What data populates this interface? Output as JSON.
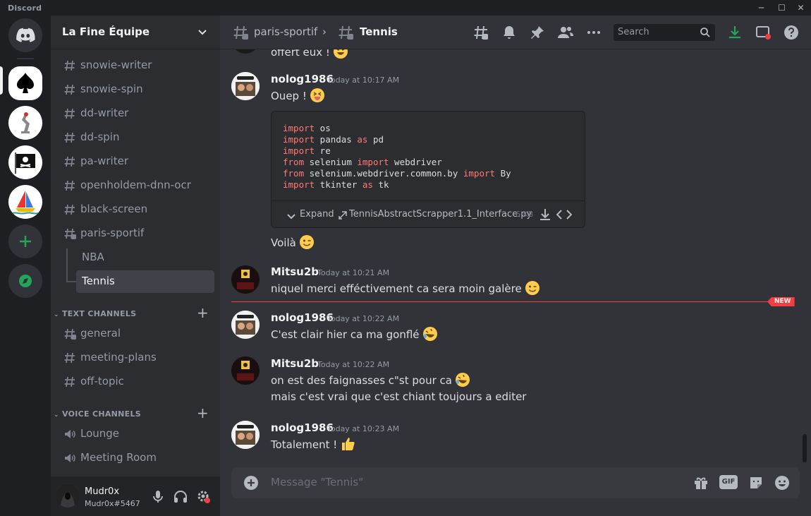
{
  "app": {
    "title": "Discord"
  },
  "window_controls": {
    "minimize": "─",
    "maximize": "☐",
    "close": "✕"
  },
  "server": {
    "name": "La Fine Équipe"
  },
  "channels": {
    "top": [
      "snowie-writer",
      "snowie-spin",
      "dd-writer",
      "dd-spin",
      "pa-writer",
      "openholdem-dnn-ocr",
      "black-screen",
      "paris-sportif"
    ],
    "threads": [
      "NBA",
      "Tennis"
    ],
    "text_category": "TEXT CHANNELS",
    "text": [
      "general",
      "meeting-plans",
      "off-topic"
    ],
    "voice_category": "VOICE CHANNELS",
    "voice": [
      "Lounge",
      "Meeting Room"
    ]
  },
  "user": {
    "name": "Mudr0x",
    "tag": "Mudr0x#5467"
  },
  "header": {
    "parent": "paris-sportif",
    "separator": "›",
    "thread": "Tennis",
    "search_placeholder": "Search"
  },
  "messages": {
    "partial_text": "offert eux !",
    "m1": {
      "author": "nolog1986",
      "time": "Today at 10:17 AM",
      "text": "Ouep !",
      "after_text": "Voilà"
    },
    "code": {
      "lines": [
        [
          [
            "kw",
            "import"
          ],
          [
            "t",
            " os"
          ]
        ],
        [
          [
            "kw",
            "import"
          ],
          [
            "t",
            " pandas "
          ],
          [
            "kw",
            "as"
          ],
          [
            "t",
            " pd"
          ]
        ],
        [
          [
            "kw",
            "import"
          ],
          [
            "t",
            " re"
          ]
        ],
        [
          [
            "kw",
            "from"
          ],
          [
            "t",
            " selenium "
          ],
          [
            "kw",
            "import"
          ],
          [
            "t",
            " webdriver"
          ]
        ],
        [
          [
            "kw",
            "from"
          ],
          [
            "t",
            " selenium.webdriver.common.by "
          ],
          [
            "kw",
            "import"
          ],
          [
            "t",
            " By"
          ]
        ],
        [
          [
            "kw",
            "import"
          ],
          [
            "t",
            " tkinter "
          ],
          [
            "kw",
            "as"
          ],
          [
            "t",
            " tk"
          ]
        ]
      ],
      "expand": "Expand",
      "filename": "TennisAbstractScrapper1.1_Interface.py",
      "size": "6 KB"
    },
    "m2": {
      "author": "Mitsu2b",
      "time": "Today at 10:21 AM",
      "text": "niquel merci efféctivement ca sera moin galère"
    },
    "new_badge": "NEW",
    "m3": {
      "author": "nolog1986",
      "time": "Today at 10:22 AM",
      "text": "C'est clair hier ca ma gonflé"
    },
    "m4": {
      "author": "Mitsu2b",
      "time": "Today at 10:22 AM",
      "text": "on est des faignasses c\"st pour ca",
      "text2": "mais c'est vrai que c'est chiant toujours a editer"
    },
    "m5": {
      "author": "nolog1986",
      "time": "Today at 10:23 AM",
      "text": "Totalement !"
    }
  },
  "composer": {
    "placeholder": "Message \"Tennis\"",
    "gif_label": "GIF"
  },
  "colors": {
    "accent": "#5865f2",
    "green": "#23a55a",
    "red": "#f23f43",
    "code_keyword": "#ff7b72"
  }
}
